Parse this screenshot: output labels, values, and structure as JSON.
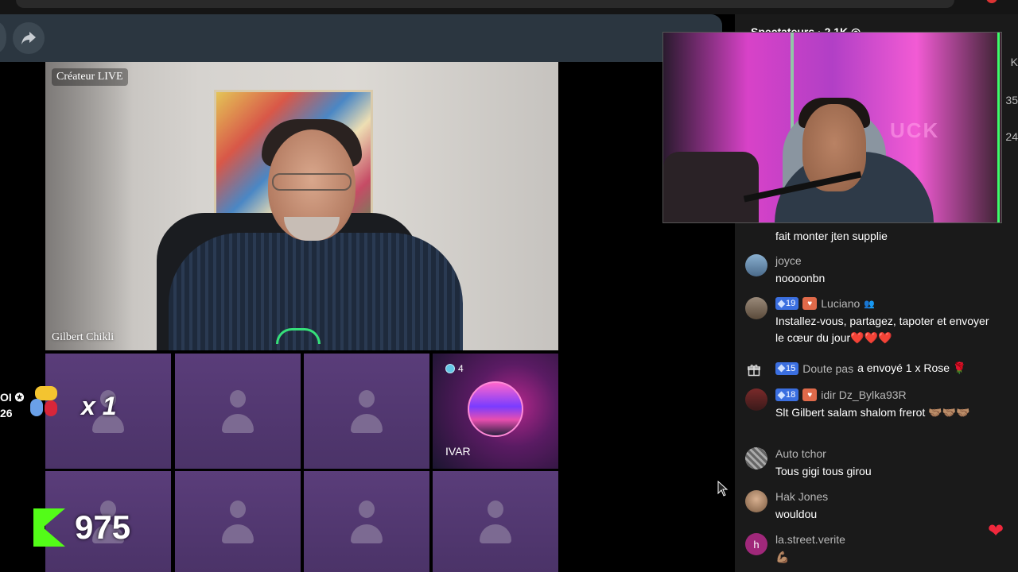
{
  "host": {
    "badge": "Créateur LIVE",
    "name": "Gilbert Chikli"
  },
  "guests": [
    {
      "name": "",
      "type": "empty"
    },
    {
      "name": "",
      "type": "empty"
    },
    {
      "name": "",
      "type": "empty"
    },
    {
      "name": "IVAR",
      "type": "user",
      "badge_count": "4"
    },
    {
      "name": "",
      "type": "empty"
    },
    {
      "name": "",
      "type": "empty"
    },
    {
      "name": "",
      "type": "empty"
    },
    {
      "name": "",
      "type": "empty"
    }
  ],
  "overlay": {
    "left_text_1": "OI ✪",
    "left_text_2": "26",
    "multiplier": "x 1",
    "k_count": "975",
    "k_color": "#53fc18"
  },
  "chat": {
    "header": "Spectateurs · 2,1K ◎",
    "right_numbers": [
      "K",
      "35",
      "24"
    ],
    "messages": [
      {
        "text": "fait monter jten supplie"
      },
      {
        "user": "joyce",
        "text": "noooonbn"
      },
      {
        "user": "Luciano",
        "level": "19",
        "text": "Installez-vous, partagez, tapoter et envoyer le cœur du jour❤️❤️❤️"
      },
      {
        "level": "15",
        "user": "Doute pas",
        "gift_text": "a envoyé 1 x Rose 🌹"
      },
      {
        "user": "idir Dz_Bylka93R",
        "level": "18",
        "text": "Slt Gilbert salam shalom frerot 🤝🏽🤝🏽🤝🏽"
      },
      {
        "user": "Auto tchor",
        "text": "Tous gigi tous girou"
      },
      {
        "user": "Hak Jones",
        "text": "wouldou"
      },
      {
        "user": "la.street.verite",
        "avatar_letter": "h",
        "text": "💪🏽"
      }
    ]
  },
  "webcam": {
    "sign": "UCK"
  },
  "colors": {
    "top_bar": "#2b3640",
    "guest_tile": "#5a3d7a",
    "chat_bg": "#1a1a1a",
    "level_badge": "#3b6fe0",
    "heart_badge": "#e06a4a"
  },
  "icons": [
    "share-icon",
    "gift-icon",
    "cursor-icon",
    "person-placeholder-icon",
    "heart-icon",
    "person-icon",
    "diamond-icon"
  ]
}
